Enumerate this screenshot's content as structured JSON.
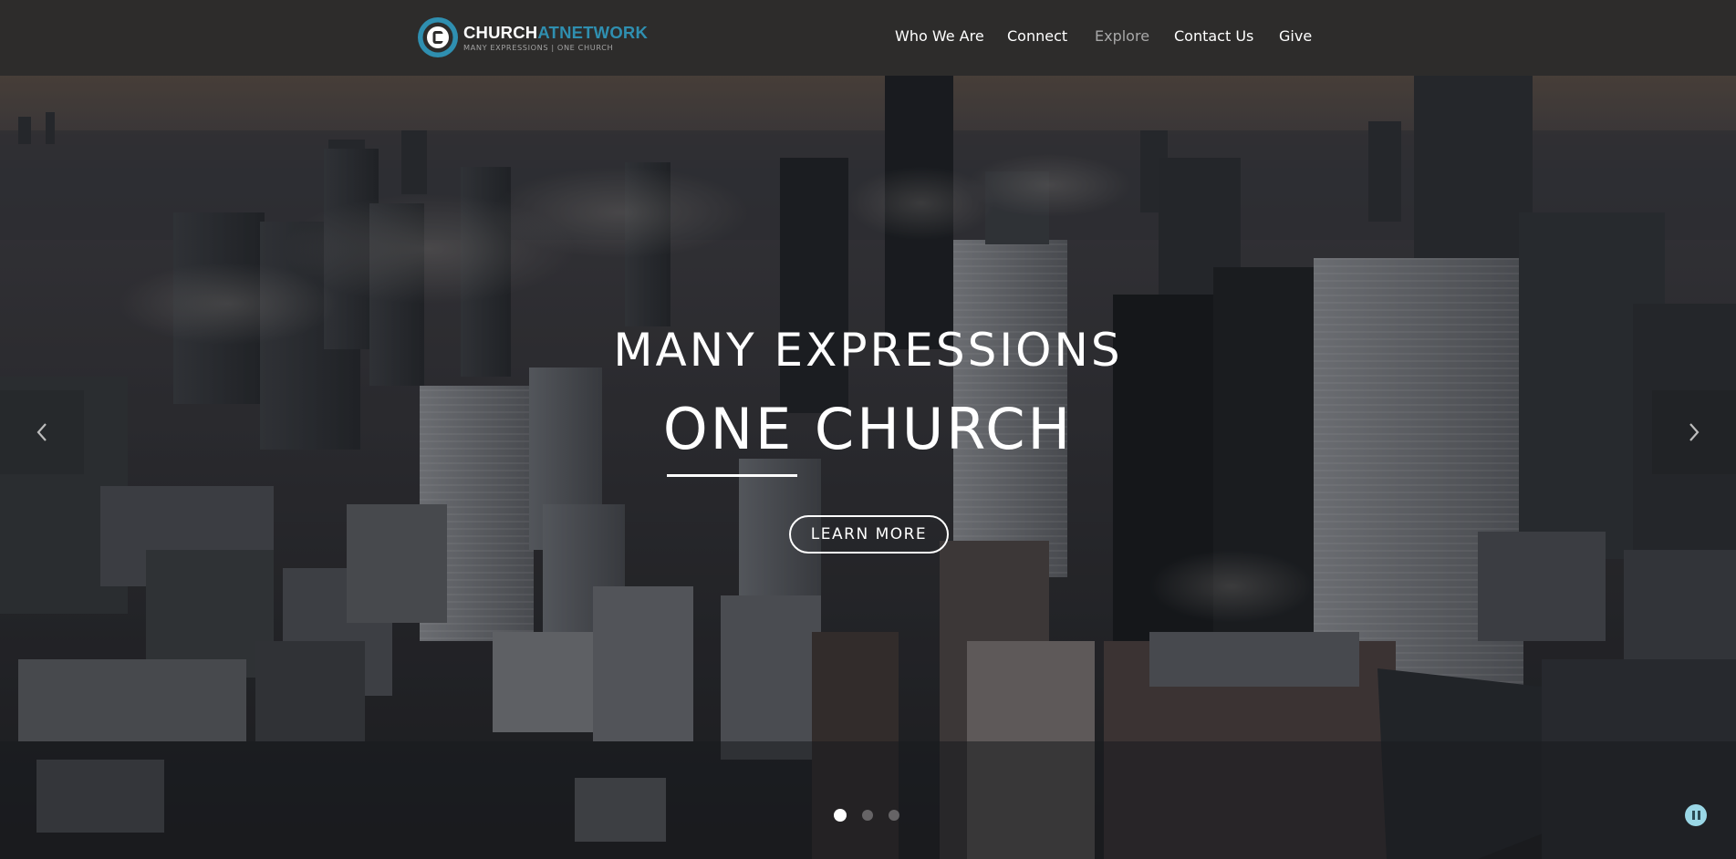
{
  "brand": {
    "name_part1": "CHURCH",
    "name_part2": "AT",
    "name_part3": "NETWORK",
    "tagline": "MANY EXPRESSIONS | ONE CHURCH",
    "accent_color": "#2f8fb0"
  },
  "nav": {
    "items": [
      {
        "label": "Who We Are",
        "state": "normal"
      },
      {
        "label": "Connect",
        "state": "normal"
      },
      {
        "label": "Explore",
        "state": "dimmed"
      },
      {
        "label": "Contact Us",
        "state": "normal"
      },
      {
        "label": "Give",
        "state": "normal"
      }
    ]
  },
  "hero": {
    "headline_line1": "MANY EXPRESSIONS",
    "headline_line2": "ONE CHURCH",
    "cta_label": "LEARN MORE",
    "background": "aerial city skyline with low clouds",
    "prev_icon": "chevron-left-icon",
    "next_icon": "chevron-right-icon"
  },
  "slider": {
    "slide_count": 3,
    "active_index": 0,
    "pause_icon": "pause-icon",
    "pause_color": "#9ad7e6"
  }
}
